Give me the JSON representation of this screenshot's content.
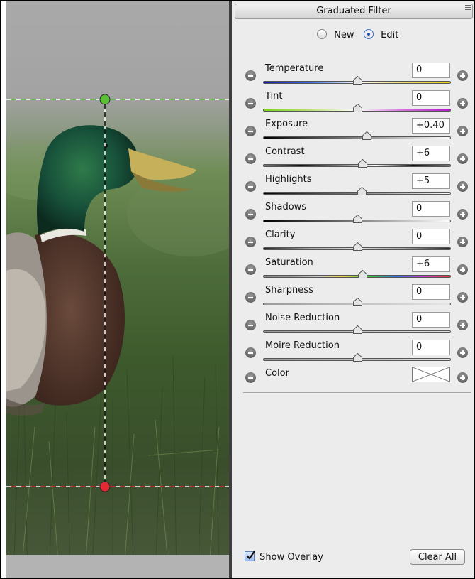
{
  "panel": {
    "title": "Graduated Filter",
    "menu_icon": "panel-menu-icon",
    "mode": {
      "options": [
        "New",
        "Edit"
      ],
      "selected": "Edit"
    }
  },
  "adjustments": [
    {
      "label": "Temperature",
      "value": "0",
      "level": 0.5
    },
    {
      "label": "Tint",
      "value": "0",
      "level": 0.5
    },
    {
      "label": "Exposure",
      "value": "+0.40",
      "level": 0.55
    },
    {
      "label": "Contrast",
      "value": "+6",
      "level": 0.53
    },
    {
      "label": "Highlights",
      "value": "+5",
      "level": 0.525
    },
    {
      "label": "Shadows",
      "value": "0",
      "level": 0.5
    },
    {
      "label": "Clarity",
      "value": "0",
      "level": 0.5
    },
    {
      "label": "Saturation",
      "value": "+6",
      "level": 0.53
    },
    {
      "label": "Sharpness",
      "value": "0",
      "level": 0.5
    },
    {
      "label": "Noise Reduction",
      "value": "0",
      "level": 0.5
    },
    {
      "label": "Moire Reduction",
      "value": "0",
      "level": 0.5
    }
  ],
  "color_row": {
    "label": "Color",
    "swatch": "none"
  },
  "footer": {
    "show_overlay_label": "Show Overlay",
    "show_overlay_checked": true,
    "clear_all_label": "Clear All"
  },
  "filter_guides": {
    "start_color": "#4fb331",
    "end_color": "#d0202a"
  }
}
